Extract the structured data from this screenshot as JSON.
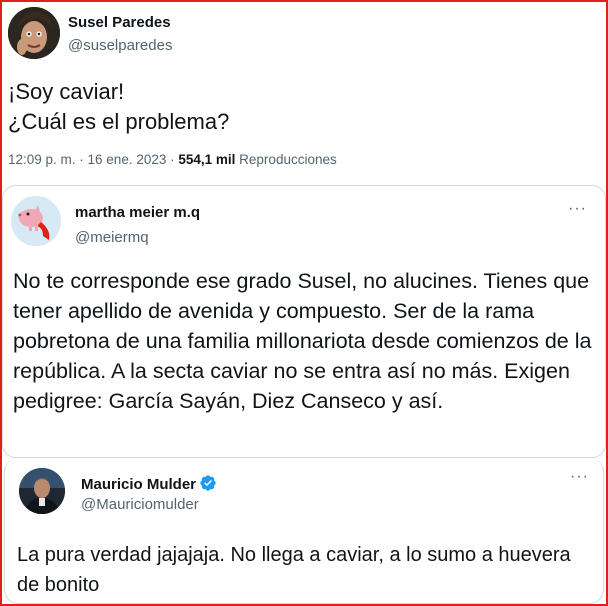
{
  "tweet": {
    "author_name": "Susel Paredes",
    "author_handle": "@suselparedes",
    "text_line1": "¡Soy caviar!",
    "text_line2": "¿Cuál es el problema?",
    "time": "12:09 p. m. · 16 ene. 2023 · ",
    "views_count": "554,1 mil",
    "views_label": "Reproducciones"
  },
  "reply1": {
    "author_name": "martha meier m.q",
    "author_handle": "@meiermq",
    "more_icon": "more-options-icon",
    "more_glyph": "···",
    "text": "No te corresponde ese grado Susel, no alucines. Tienes que tener apellido de avenida y compuesto. Ser de la rama pobretona de una familia millonariota desde comienzos de la república. A la secta caviar no se entra así no más. Exigen pedigree: García Sayán, Diez Canseco y así."
  },
  "reply2": {
    "author_name": "Mauricio Mulder",
    "author_handle": "@Mauriciomulder",
    "verified_icon": "verified-badge-icon",
    "more_glyph": "···",
    "text": "La pura verdad jajajaja. No llega a caviar, a lo sumo a huevera de bonito"
  },
  "colors": {
    "border_accent": "#e0201b",
    "verified_blue": "#1d9bf0",
    "secondary_text": "#536471",
    "primary_text": "#0f1419"
  }
}
